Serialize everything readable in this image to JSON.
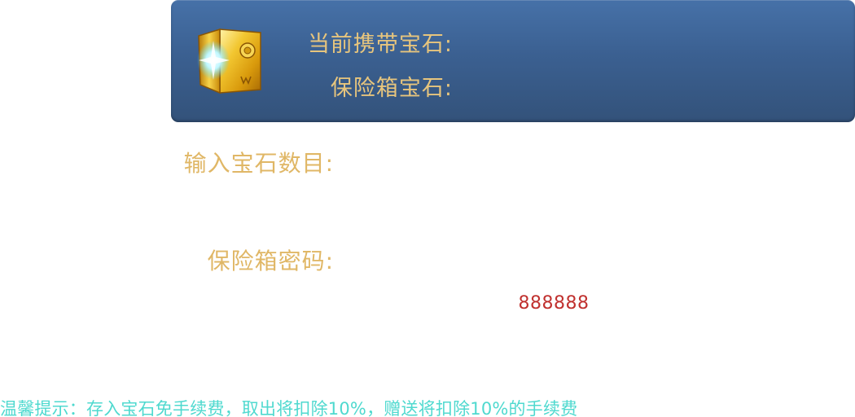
{
  "panel": {
    "carry_label": "当前携带宝石:",
    "safe_label": "保险箱宝石:",
    "icon": "vault-icon"
  },
  "form": {
    "amount_label": "输入宝石数目:",
    "password_label": "保险箱密码:",
    "password_hint": "888888"
  },
  "tip": "温馨提示：存入宝石免手续费，取出将扣除10%，赠送将扣除10%的手续费",
  "colors": {
    "panel_top": "#4671a8",
    "panel_bottom": "#33527a",
    "gold_text": "#e0b766",
    "hint_red": "#c0312f",
    "tip_cyan": "#4fd9cf"
  }
}
